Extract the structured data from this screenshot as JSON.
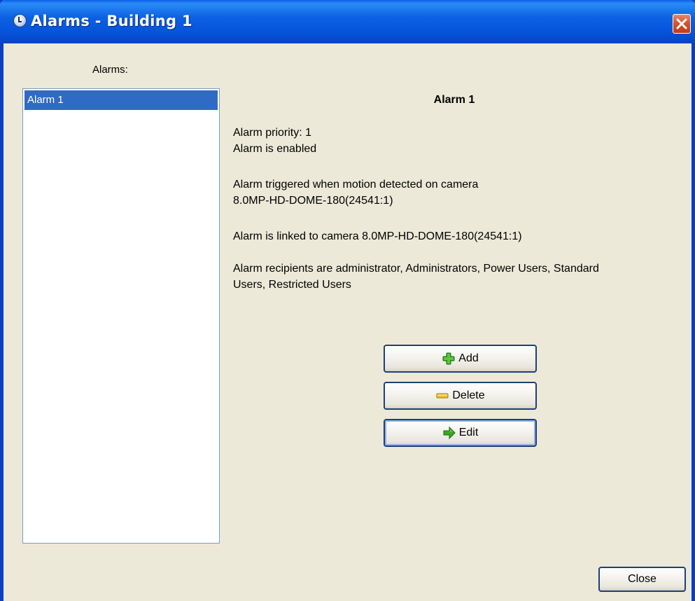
{
  "window": {
    "title": "Alarms - Building 1",
    "title_icon": "clock-icon",
    "close_icon": "close-icon"
  },
  "alarms_label": "Alarms:",
  "alarm_list": {
    "items": [
      {
        "label": "Alarm 1",
        "selected": true
      }
    ]
  },
  "details": {
    "title": "Alarm 1",
    "priority": "Alarm priority: 1",
    "enabled": "Alarm is enabled",
    "trigger_line1": "Alarm triggered when motion detected on camera",
    "trigger_line2": "8.0MP-HD-DOME-180(24541:1)",
    "linked": "Alarm is linked to camera 8.0MP-HD-DOME-180(24541:1)",
    "recipients_line1": "Alarm recipients are administrator, Administrators, Power Users, Standard",
    "recipients_line2": "Users, Restricted Users"
  },
  "buttons": {
    "add": {
      "label": "Add",
      "icon": "plus-icon"
    },
    "delete": {
      "label": "Delete",
      "icon": "minus-icon"
    },
    "edit": {
      "label": "Edit",
      "icon": "arrow-right-icon"
    },
    "close": {
      "label": "Close"
    }
  },
  "colors": {
    "titlebar": "#0553d9",
    "window_bg": "#ece9d8",
    "selection": "#316ac5",
    "close_red": "#d8532c",
    "plus_green": "#3aa623",
    "minus_yellow": "#f2c02c"
  }
}
